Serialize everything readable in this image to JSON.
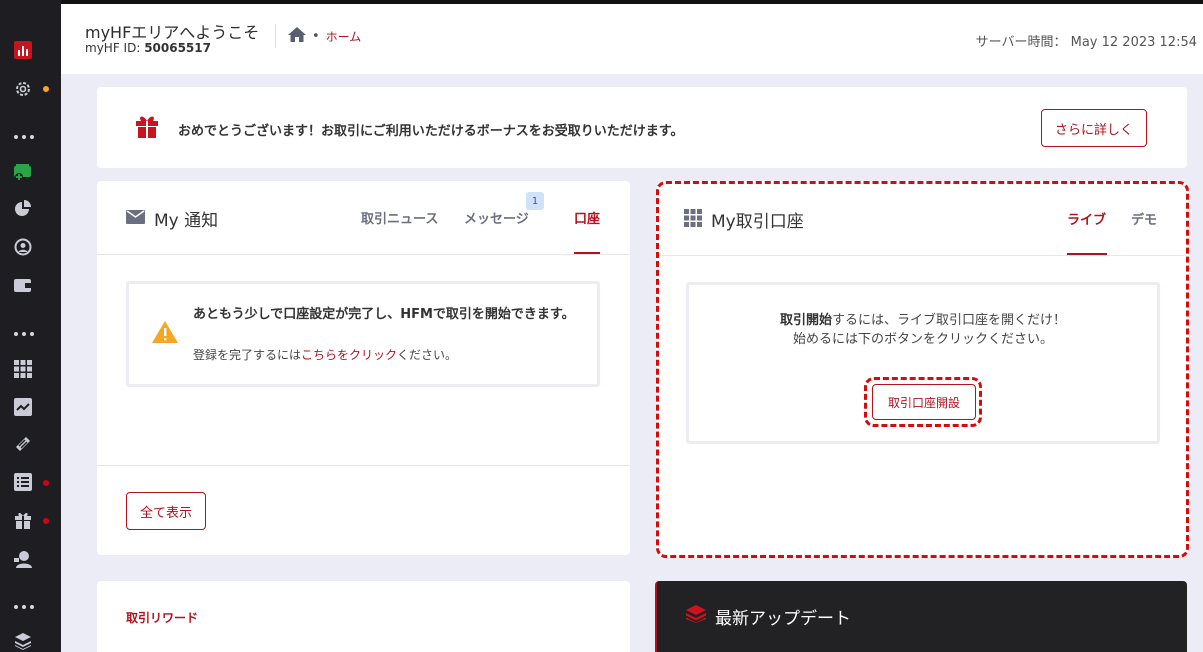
{
  "header": {
    "welcome": "myHFエリアへようこそ",
    "id_label": "myHF ID:",
    "id_value": "50065517",
    "breadcrumb_separator": "•",
    "breadcrumb_home": "ホーム",
    "server_time": "サーバー時間： May 12 2023 12:54"
  },
  "sidebar": {
    "icons": [
      "bar-chart-icon",
      "settings-icon",
      "more-icon",
      "deposit-icon",
      "pie-chart-icon",
      "profile-icon",
      "wallet-icon",
      "more-icon",
      "apps-icon",
      "trending-icon",
      "tools-icon",
      "list-icon",
      "gift-icon",
      "support-icon",
      "more-icon",
      "layers-icon"
    ],
    "badge_colors": {
      "settings": "#f5a623",
      "list": "#d0021b",
      "gift": "#d0021b"
    }
  },
  "bonus": {
    "text": "おめでとうございます！お取引にご利用いただけるボーナスをお受取りいただけます。",
    "button": "さらに詳しく"
  },
  "notifications": {
    "title": "My 通知",
    "tabs": [
      {
        "label": "取引ニュース",
        "active": false
      },
      {
        "label": "メッセージ",
        "active": false,
        "badge": "1"
      },
      {
        "label": "口座",
        "active": true
      }
    ],
    "alert_title": "あともう少しで口座設定が完了し、HFMで取引を開始できます。",
    "alert_sub_prefix": "登録を完了するには",
    "alert_sub_link": "こちらをクリック",
    "alert_sub_suffix": "ください。",
    "show_all": "全て表示"
  },
  "trading_accounts": {
    "title": "My取引口座",
    "tabs": [
      {
        "label": "ライブ",
        "active": true
      },
      {
        "label": "デモ",
        "active": false
      }
    ],
    "line1_bold": "取引開始",
    "line1_rest": "するには、ライブ取引口座を開くだけ！",
    "line2": "始めるには下のボタンをクリックください。",
    "open_button": "取引口座開設"
  },
  "rewards": {
    "title": "取引リワード"
  },
  "updates": {
    "title": "最新アップデート"
  },
  "colors": {
    "accent": "#b3121d",
    "highlight": "#d40c0c",
    "sidebar": "#1e1e22",
    "background": "#ebecf5"
  }
}
